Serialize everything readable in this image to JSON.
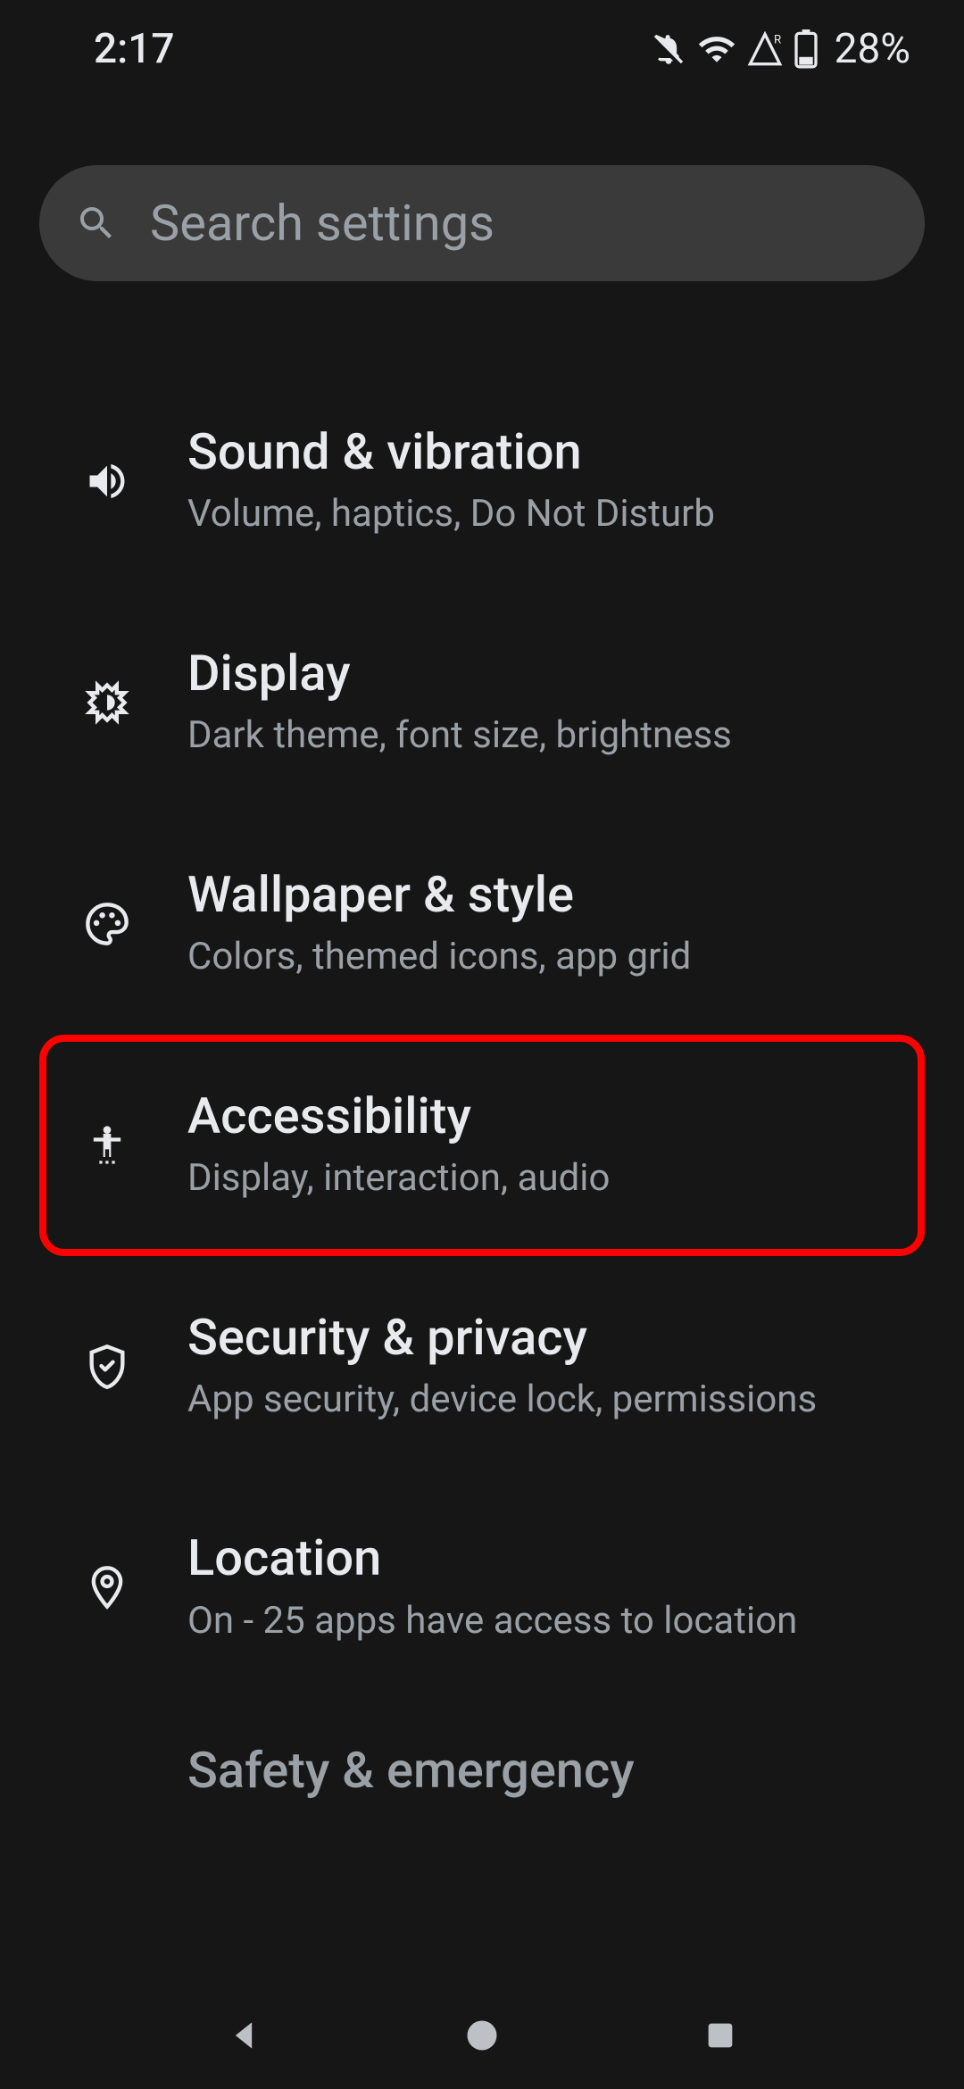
{
  "status_bar": {
    "time": "2:17",
    "battery": "28%"
  },
  "search": {
    "placeholder": "Search settings"
  },
  "settings": {
    "items": [
      {
        "title": "Sound & vibration",
        "subtitle": "Volume, haptics, Do Not Disturb",
        "icon": "volume-icon",
        "highlighted": false
      },
      {
        "title": "Display",
        "subtitle": "Dark theme, font size, brightness",
        "icon": "brightness-icon",
        "highlighted": false
      },
      {
        "title": "Wallpaper & style",
        "subtitle": "Colors, themed icons, app grid",
        "icon": "palette-icon",
        "highlighted": false
      },
      {
        "title": "Accessibility",
        "subtitle": "Display, interaction, audio",
        "icon": "accessibility-icon",
        "highlighted": true
      },
      {
        "title": "Security & privacy",
        "subtitle": "App security, device lock, permissions",
        "icon": "shield-icon",
        "highlighted": false
      },
      {
        "title": "Location",
        "subtitle": "On - 25 apps have access to location",
        "icon": "location-icon",
        "highlighted": false
      },
      {
        "title": "Safety & emergency",
        "subtitle": "",
        "icon": "emergency-icon",
        "highlighted": false
      }
    ]
  }
}
